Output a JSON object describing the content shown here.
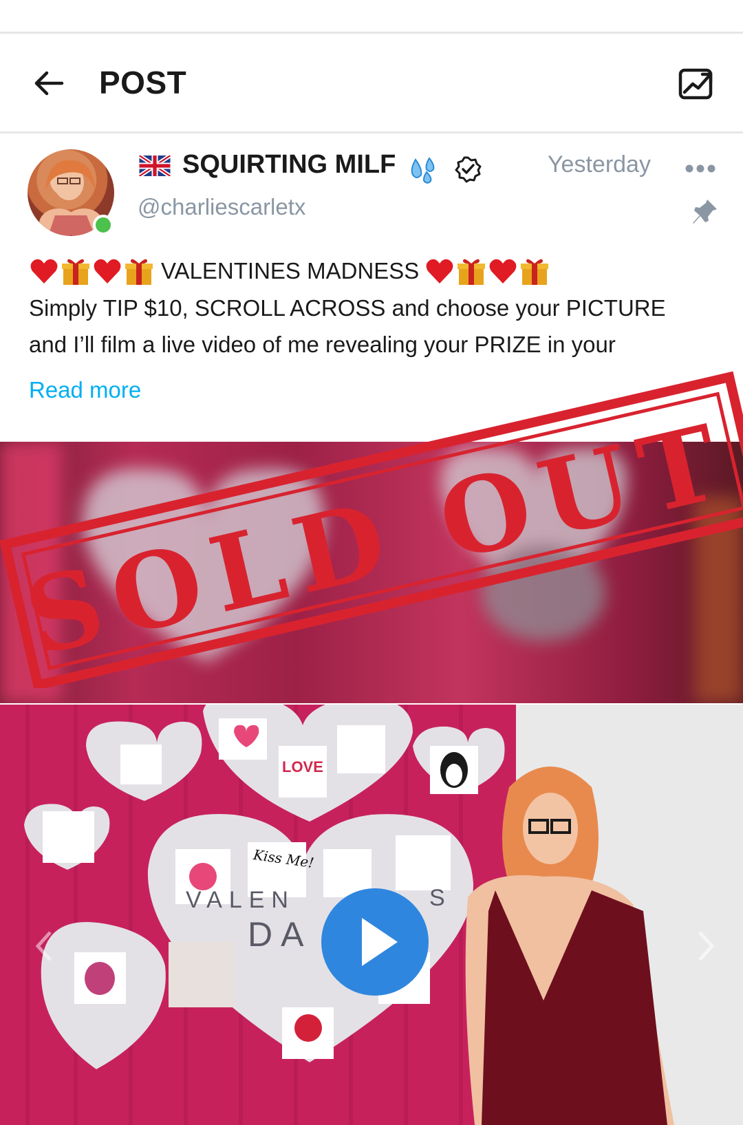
{
  "header": {
    "title": "POST"
  },
  "post": {
    "display_name": "SQUIRTING MILF",
    "handle": "@charliescarletx",
    "timestamp": "Yesterday",
    "title_line": "VALENTINES MADNESS",
    "body_line_1": "Simply TIP $10, SCROLL ACROSS and choose your PICTURE",
    "body_line_2": "and I’ll film a live video of me revealing your PRIZE in your",
    "read_more": "Read more"
  },
  "media": {
    "stamp_text": "SOLD OUT",
    "decor_word_1": "VALEN",
    "decor_word_2": "S",
    "decor_word_3": "DA",
    "kiss_note": "Kiss Me!",
    "love_tile": "LOVE"
  },
  "colors": {
    "accent": "#00aff0",
    "muted": "#8a96a3",
    "stamp_red": "#d8232f",
    "play_blue": "#2f86de",
    "backdrop_pink": "#c61f5a",
    "online_green": "#4cc14c"
  },
  "icons": {
    "back": "arrow-left-icon",
    "stats": "statistics-icon",
    "flag": "uk-flag-icon",
    "drops": "water-drops-icon",
    "verified": "verified-badge-icon",
    "more": "more-dots-icon",
    "pin": "pin-icon",
    "heart": "red-heart-icon",
    "gift": "gift-icon",
    "play": "play-icon"
  }
}
